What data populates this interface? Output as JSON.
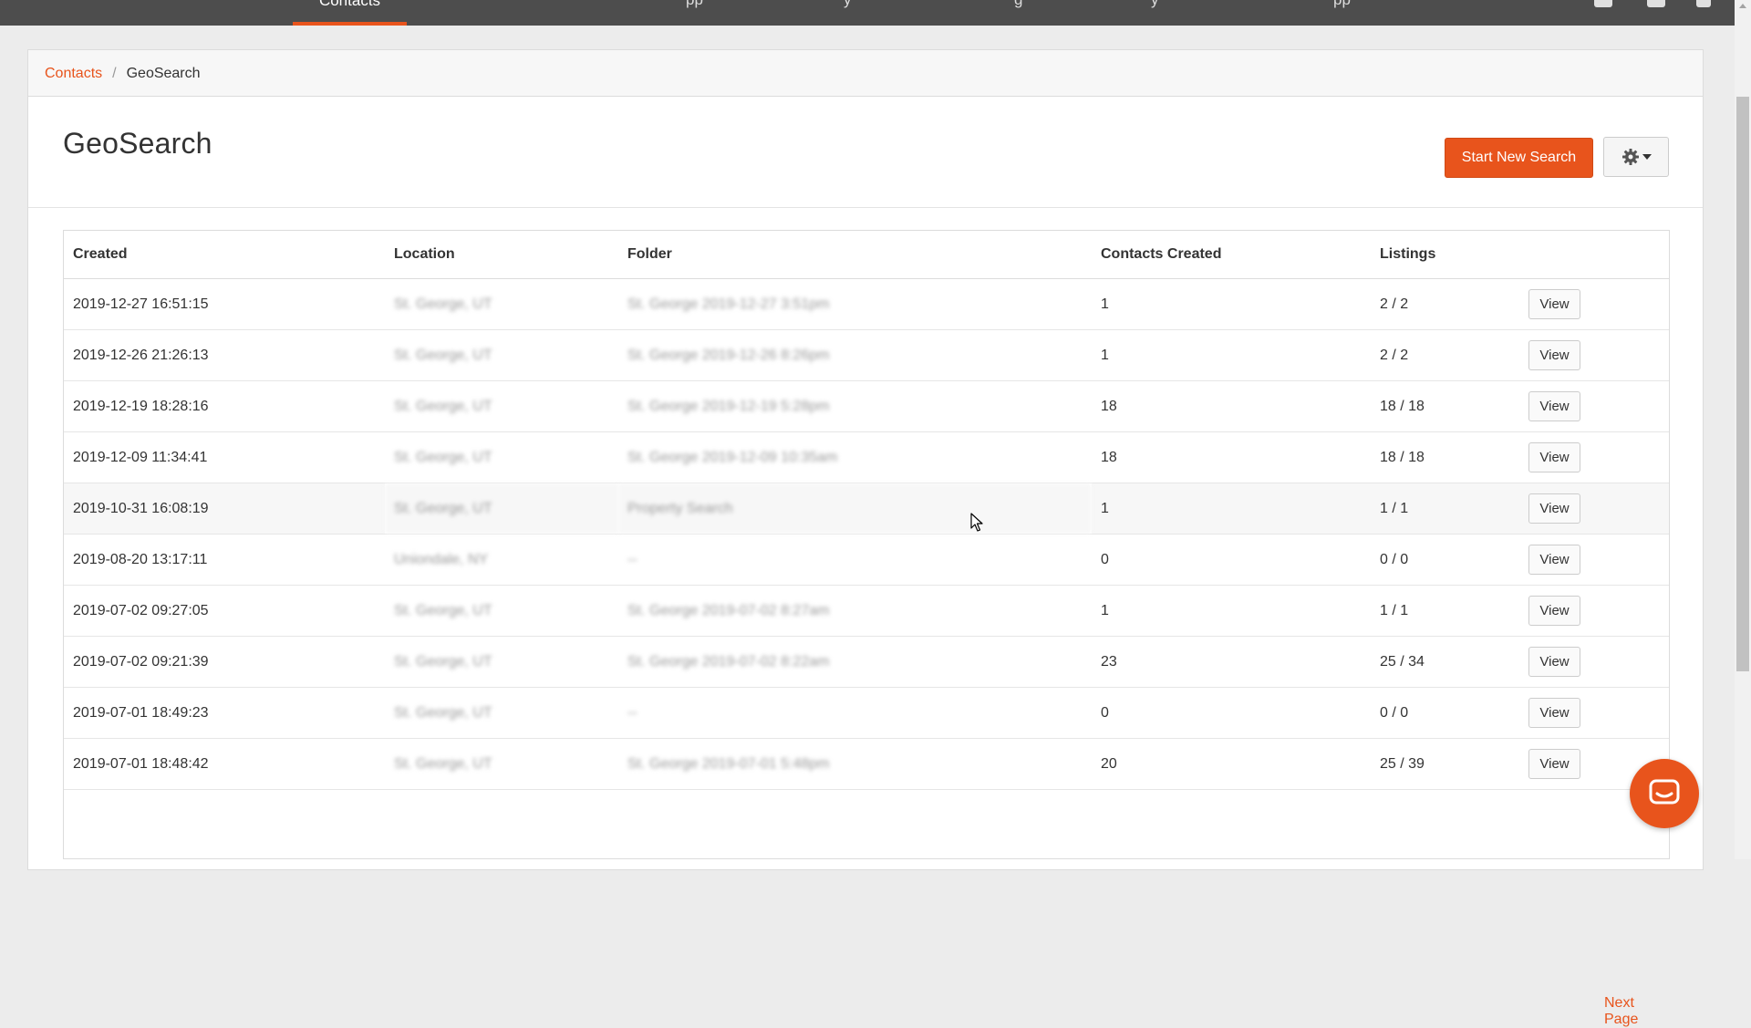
{
  "topnav": {
    "active_label": "Contacts",
    "ghost_items": [
      "pp",
      "y",
      "g",
      "y",
      "pp"
    ]
  },
  "breadcrumb": {
    "parent": "Contacts",
    "separator": "/",
    "current": "GeoSearch"
  },
  "header": {
    "title": "GeoSearch",
    "start_button": "Start New Search",
    "settings_icon": "gear-icon"
  },
  "table": {
    "columns": [
      "Created",
      "Location",
      "Folder",
      "Contacts Created",
      "Listings",
      ""
    ],
    "rows": [
      {
        "created": "2019-12-27 16:51:15",
        "location": "St. George, UT",
        "folder": "St. George 2019-12-27 3:51pm",
        "contacts": "1",
        "listings": "2 / 2",
        "action": "View"
      },
      {
        "created": "2019-12-26 21:26:13",
        "location": "St. George, UT",
        "folder": "St. George 2019-12-26 8:26pm",
        "contacts": "1",
        "listings": "2 / 2",
        "action": "View"
      },
      {
        "created": "2019-12-19 18:28:16",
        "location": "St. George, UT",
        "folder": "St. George 2019-12-19 5:28pm",
        "contacts": "18",
        "listings": "18 / 18",
        "action": "View"
      },
      {
        "created": "2019-12-09 11:34:41",
        "location": "St. George, UT",
        "folder": "St. George 2019-12-09 10:35am",
        "contacts": "18",
        "listings": "18 / 18",
        "action": "View"
      },
      {
        "created": "2019-10-31 16:08:19",
        "location": "St. George, UT",
        "folder": "Property Search",
        "contacts": "1",
        "listings": "1 / 1",
        "action": "View"
      },
      {
        "created": "2019-08-20 13:17:11",
        "location": "Uniondale, NY",
        "folder": "--",
        "contacts": "0",
        "listings": "0 / 0",
        "action": "View"
      },
      {
        "created": "2019-07-02 09:27:05",
        "location": "St. George, UT",
        "folder": "St. George 2019-07-02 8:27am",
        "contacts": "1",
        "listings": "1 / 1",
        "action": "View"
      },
      {
        "created": "2019-07-02 09:21:39",
        "location": "St. George, UT",
        "folder": "St. George 2019-07-02 8:22am",
        "contacts": "23",
        "listings": "25 / 34",
        "action": "View"
      },
      {
        "created": "2019-07-01 18:49:23",
        "location": "St. George, UT",
        "folder": "--",
        "contacts": "0",
        "listings": "0 / 0",
        "action": "View"
      },
      {
        "created": "2019-07-01 18:48:42",
        "location": "St. George, UT",
        "folder": "St. George 2019-07-01 5:48pm",
        "contacts": "20",
        "listings": "25 / 39",
        "action": "View"
      }
    ]
  },
  "pagination": {
    "next": "Next Page"
  },
  "colors": {
    "accent": "#e8541c",
    "topbar": "#4d4d4d"
  },
  "chat": {
    "icon": "chat-icon"
  }
}
